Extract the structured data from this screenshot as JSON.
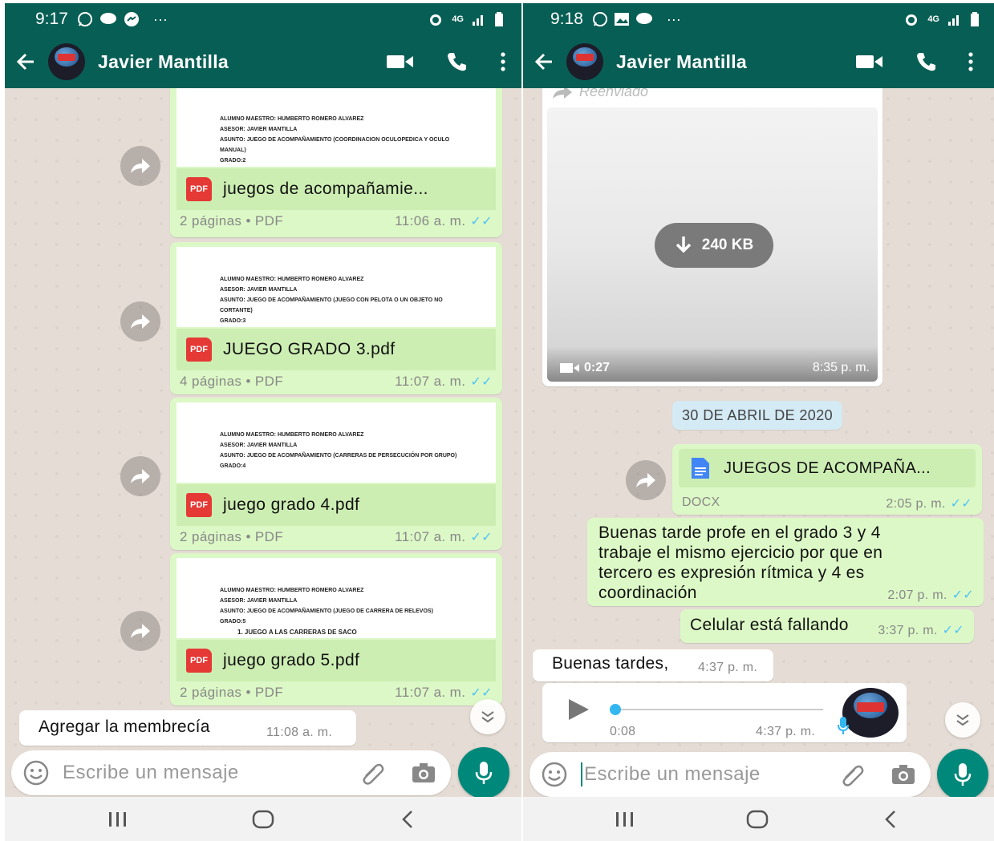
{
  "left": {
    "status_time": "9:17",
    "contact_name": "Javier Mantilla",
    "docs": [
      {
        "preview_lines": [
          "ALUMNO MAESTRO: HUMBERTO ROMERO ALVAREZ",
          "ASESOR: JAVIER MANTILLA",
          "ASUNTO: JUEGO DE ACOMPAÑAMIENTO (COORDINACION OCULOPEDICA Y OCULO MANUAL)",
          "GRADO:2"
        ],
        "name": "juegos de acompañamie...",
        "pages": "2 páginas • PDF",
        "time": "11:06 a. m."
      },
      {
        "preview_lines": [
          "ALUMNO MAESTRO: HUMBERTO ROMERO ALVAREZ",
          "ASESOR: JAVIER MANTILLA",
          "ASUNTO: JUEGO DE ACOMPAÑAMIENTO (JUEGO CON PELOTA O UN OBJETO NO CORTANTE)",
          "GRADO:3"
        ],
        "name": "JUEGO GRADO 3.pdf",
        "pages": "4 páginas • PDF",
        "time": "11:07 a. m."
      },
      {
        "preview_lines": [
          "ALUMNO MAESTRO: HUMBERTO ROMERO ALVAREZ",
          "ASESOR: JAVIER MANTILLA",
          "ASUNTO: JUEGO DE ACOMPAÑAMIENTO (CARRERAS DE PERSECUCIÓN POR GRUPO)",
          "GRADO:4"
        ],
        "name": "juego grado 4.pdf",
        "pages": "2 páginas • PDF",
        "time": "11:07 a. m."
      },
      {
        "preview_lines": [
          "ALUMNO MAESTRO: HUMBERTO ROMERO ALVAREZ",
          "ASESOR: JAVIER MANTILLA",
          "ASUNTO: JUEGO DE ACOMPAÑAMIENTO (JUEGO DE CARRERA DE RELEVOS)",
          "GRADO:5",
          "1. JUEGO A LAS CARRERAS DE SACO"
        ],
        "name": "juego grado 5.pdf",
        "pages": "2 páginas • PDF",
        "time": "11:07 a. m."
      }
    ],
    "incoming_text": "Agregar la membrecía",
    "incoming_time": "11:08 a. m.",
    "input_placeholder": "Escribe un mensaje"
  },
  "right": {
    "status_time": "9:18",
    "contact_name": "Javier Mantilla",
    "forwarded_label": "Reenviado",
    "video_size": "240 KB",
    "video_duration": "0:27",
    "video_time": "8:35 p. m.",
    "date_chip": "30 DE ABRIL DE 2020",
    "docx_name": "JUEGOS DE ACOMPAÑA...",
    "docx_type": "DOCX",
    "docx_time": "2:05 p. m.",
    "msg1_text": "Buenas tarde profe en el grado 3 y 4 trabaje el mismo ejercicio por que en tercero es expresión rítmica y 4 es coordinación",
    "msg1_time": "2:07 p. m.",
    "msg2_text": "Celular está fallando",
    "msg2_time": "3:37 p. m.",
    "incoming_text": "Buenas tardes,",
    "incoming_time": "4:37 p. m.",
    "voice_duration": "0:08",
    "voice_time": "4:37 p. m.",
    "input_placeholder": "Escribe un mensaje"
  }
}
